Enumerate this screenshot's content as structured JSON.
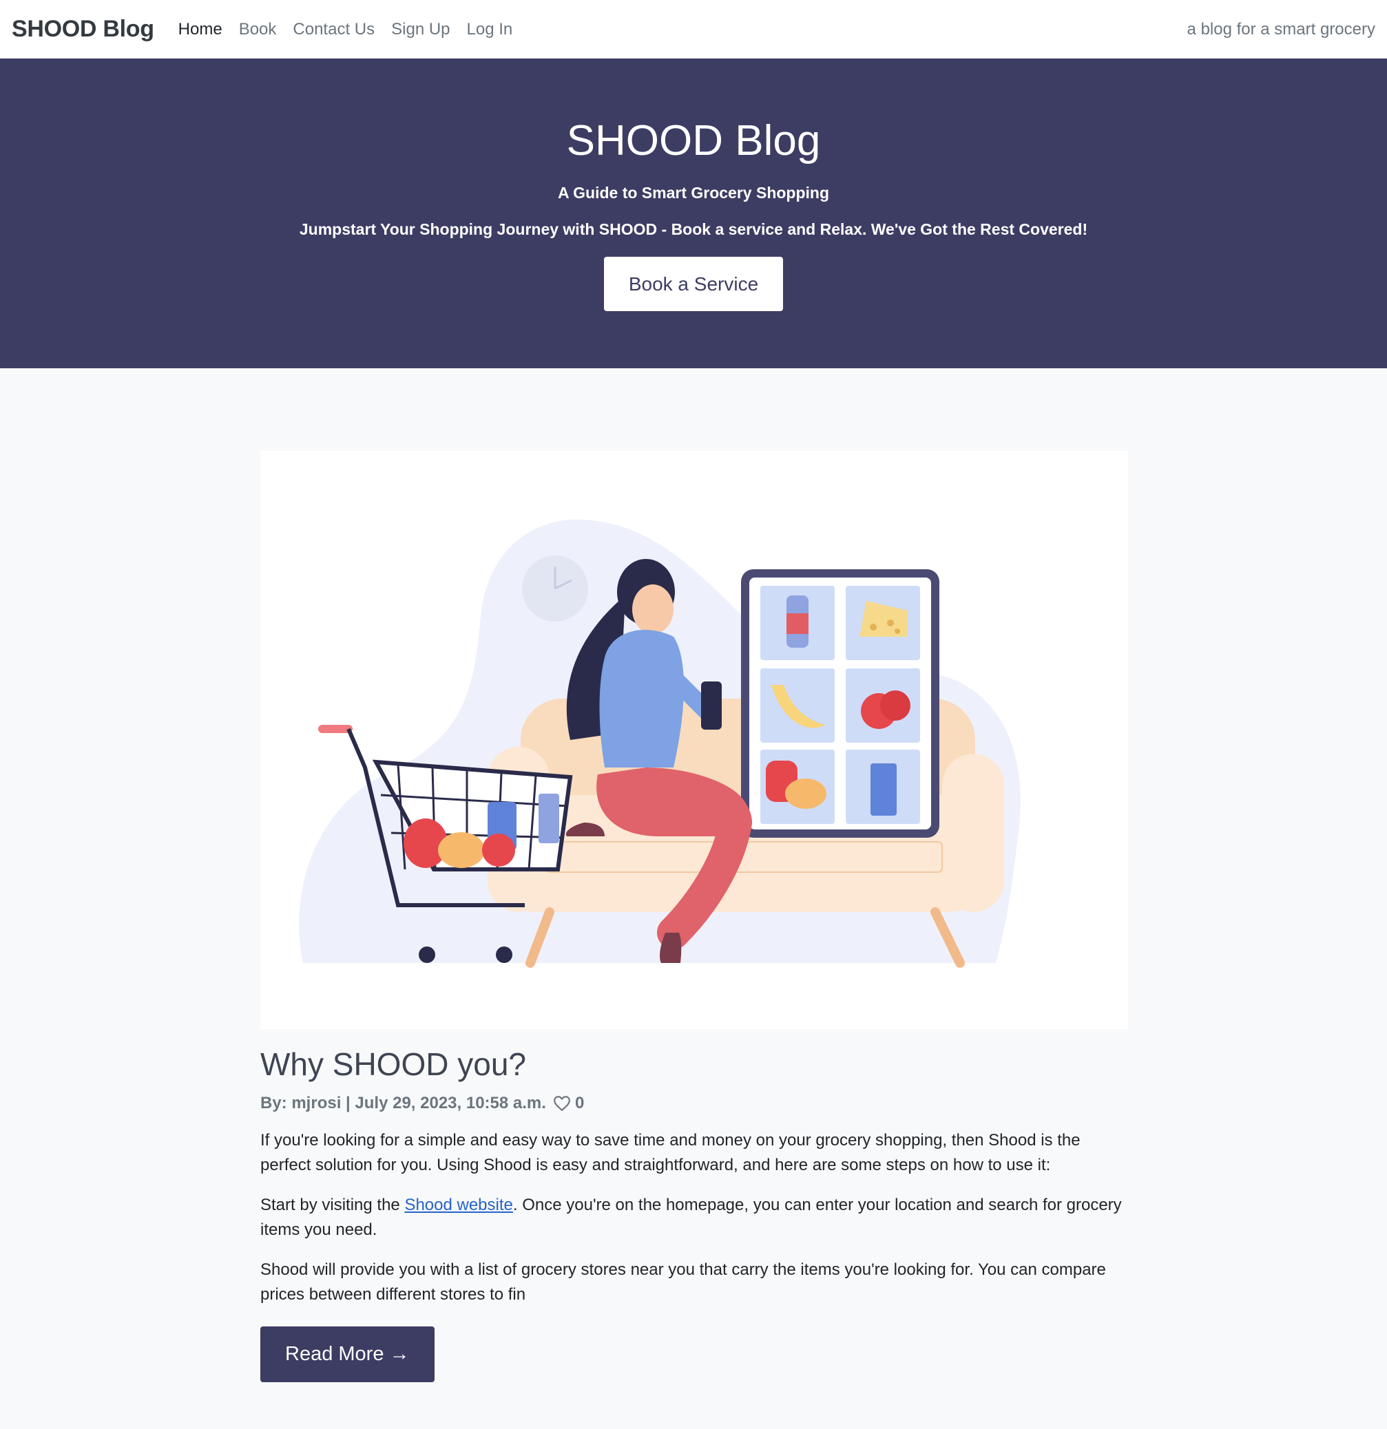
{
  "navbar": {
    "brand": "SHOOD Blog",
    "links": [
      "Home",
      "Book",
      "Contact Us",
      "Sign Up",
      "Log In"
    ],
    "tagline": "a blog for a smart grocery"
  },
  "hero": {
    "title": "SHOOD Blog",
    "subtitle": "A Guide to Smart Grocery Shopping",
    "tagline": "Jumpstart Your Shopping Journey with SHOOD - Book a service and Relax. We've Got the Rest Covered!",
    "button": "Book a Service"
  },
  "post": {
    "title": "Why SHOOD you?",
    "meta": "By: mjrosi | July 29, 2023, 10:58 a.m.",
    "likes": "0",
    "p1": "If you're looking for a simple and easy way to save time and money on your grocery shopping, then Shood is the perfect solution for you. Using Shood is easy and straightforward, and here are some steps on how to use it:",
    "p2_before": "Start by visiting the ",
    "p2_link": "Shood website",
    "p2_after": ". Once you're on the homepage, you can enter your location and search for grocery items you need.",
    "p3": "Shood will provide you with a list of grocery stores near you that carry the items you're looking for. You can compare prices between different stores to fin",
    "read_more": "Read More →"
  },
  "colors": {
    "hero_bg": "#3d3c63",
    "page_bg": "#f8f9fb",
    "link": "#2563c9"
  }
}
